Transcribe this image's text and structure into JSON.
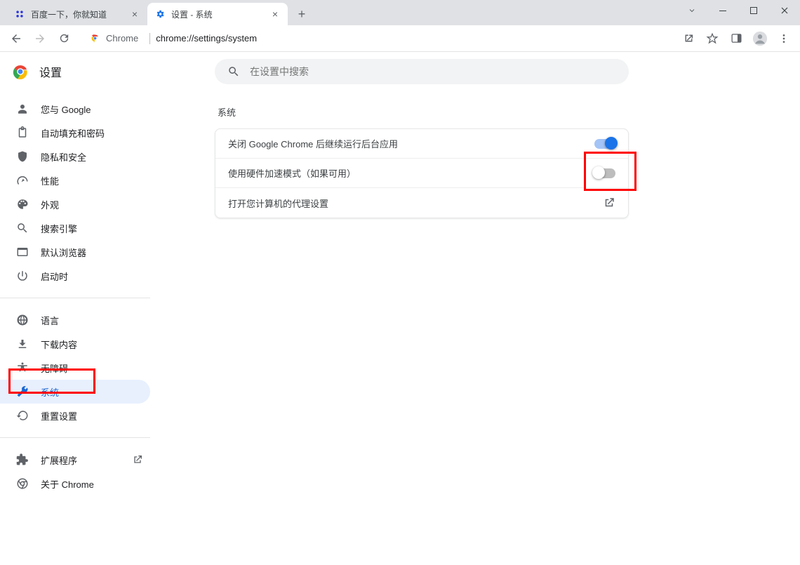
{
  "tabs": [
    {
      "title": "百度一下，你就知道",
      "active": false
    },
    {
      "title": "设置 - 系统",
      "active": true
    }
  ],
  "omnibox": {
    "secure_label": "Chrome",
    "url_display": "chrome://settings/system"
  },
  "header": {
    "title": "设置"
  },
  "search": {
    "placeholder": "在设置中搜索"
  },
  "sidebar": {
    "groups": [
      [
        {
          "id": "you-google",
          "label": "您与 Google"
        },
        {
          "id": "autofill",
          "label": "自动填充和密码"
        },
        {
          "id": "privacy",
          "label": "隐私和安全"
        },
        {
          "id": "performance",
          "label": "性能"
        },
        {
          "id": "appearance",
          "label": "外观"
        },
        {
          "id": "search-engine",
          "label": "搜索引擎"
        },
        {
          "id": "default-browser",
          "label": "默认浏览器"
        },
        {
          "id": "on-startup",
          "label": "启动时"
        }
      ],
      [
        {
          "id": "languages",
          "label": "语言"
        },
        {
          "id": "downloads",
          "label": "下载内容"
        },
        {
          "id": "accessibility",
          "label": "无障碍"
        },
        {
          "id": "system",
          "label": "系统",
          "selected": true
        },
        {
          "id": "reset",
          "label": "重置设置"
        }
      ],
      [
        {
          "id": "extensions",
          "label": "扩展程序",
          "external": true
        },
        {
          "id": "about",
          "label": "关于 Chrome"
        }
      ]
    ]
  },
  "main": {
    "section_title": "系统",
    "rows": [
      {
        "id": "bg-apps",
        "label": "关闭 Google Chrome 后继续运行后台应用",
        "type": "toggle",
        "value": true
      },
      {
        "id": "hw-accel",
        "label": "使用硬件加速模式（如果可用）",
        "type": "toggle",
        "value": false
      },
      {
        "id": "proxy",
        "label": "打开您计算机的代理设置",
        "type": "launch"
      }
    ]
  }
}
